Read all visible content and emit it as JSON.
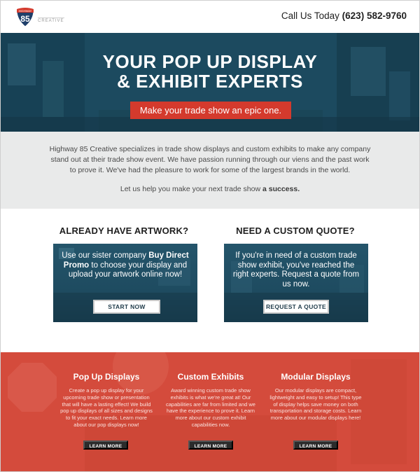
{
  "header": {
    "logo_number": "85",
    "logo_top": "HIGHWAY",
    "logo_word": "CREATIVE",
    "phone_prefix": "Call Us Today ",
    "phone_number": "(623) 582-9760"
  },
  "hero": {
    "title_line1": "YOUR POP UP DISPLAY",
    "title_line2": "& EXHIBIT EXPERTS",
    "cta_label": "Make your trade show an epic one."
  },
  "intro": {
    "body": "Highway 85 Creative specializes in trade show displays and custom exhibits to make any company stand out at their trade show event. We have passion running through our viens and the past work to prove it. We've had the pleasure to work for some of the largest brands in the world.",
    "sub_prefix": "Let us help you make your next trade show ",
    "sub_bold": "a success."
  },
  "columns": [
    {
      "heading": "ALREADY HAVE ARTWORK?",
      "text_before": "Use our sister company ",
      "text_bold": "Buy Direct Promo",
      "text_after": " to choose your display and upload your artwork online now!",
      "button": "START NOW"
    },
    {
      "heading": "NEED A CUSTOM QUOTE?",
      "text": "If you're in need of a custom trade show exhibit, you've reached the right experts. Request a quote from us now.",
      "button": "REQUEST A QUOTE"
    }
  ],
  "services": [
    {
      "title": "Pop Up Displays",
      "text": "Create a pop up display for your upcoming trade show or presentation that will have a lasting effect! We build pop up displays of all sizes and designs to fit your exact needs. Learn more about our pop displays now!",
      "button": "LEARN MORE"
    },
    {
      "title": "Custom Exhibits",
      "text": "Award winning custom trade show exhibits is what we're great at! Our capabilities are far from limited and we have the experience to prove it. Learn more about our custom exhibit capabilities now.",
      "button": "LEARN MORE"
    },
    {
      "title": "Modular Displays",
      "text": "Our modular displays are compact, lightweight and easy to setup! This type of display helps save money on both transportation and storage costs. Learn more about our modular displays here!",
      "button": "LEARN MORE"
    }
  ],
  "colors": {
    "hero_bg": "#1f5068",
    "accent_red": "#d43a2d",
    "intro_bg": "#e9eaea",
    "services_bg": "#d44b3c",
    "button_dark": "#2b2b2b"
  }
}
